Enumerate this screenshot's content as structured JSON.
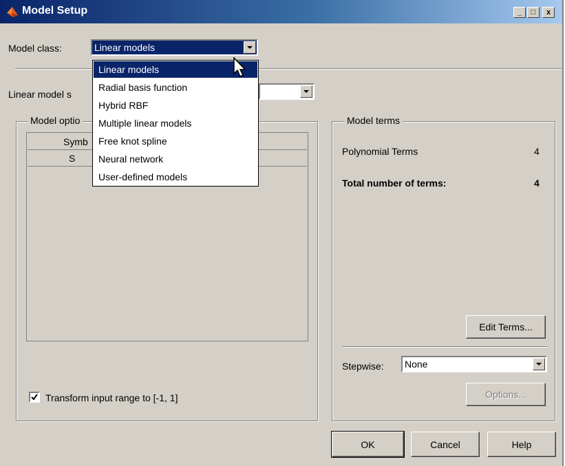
{
  "window": {
    "title": "Model Setup",
    "buttons": [
      "_",
      "□",
      "x"
    ]
  },
  "model_class": {
    "label": "Model class:",
    "value": "Linear models"
  },
  "dropdown": {
    "options": [
      "Linear models",
      "Radial basis function",
      "Hybrid RBF",
      "Multiple linear models",
      "Free knot spline",
      "Neural network",
      "User-defined models"
    ],
    "selected": "Linear models"
  },
  "linear_model_subclass": {
    "label_visible": "Linear model s"
  },
  "model_options": {
    "title_visible": "Model optio",
    "table_headers_visible": [
      "Symb",
      "S"
    ]
  },
  "model_terms": {
    "title": "Model terms",
    "rows": [
      {
        "label": "Polynomial Terms",
        "value": "4"
      },
      {
        "label": "Total number of terms:",
        "value": "4"
      }
    ],
    "edit_terms_label": "Edit Terms...",
    "stepwise_label": "Stepwise:",
    "stepwise_value": "None",
    "options_label": "Options..."
  },
  "transform": {
    "label": "Transform input range to [-1, 1]",
    "checked": true
  },
  "footer": {
    "ok": "OK",
    "cancel": "Cancel",
    "help": "Help"
  }
}
